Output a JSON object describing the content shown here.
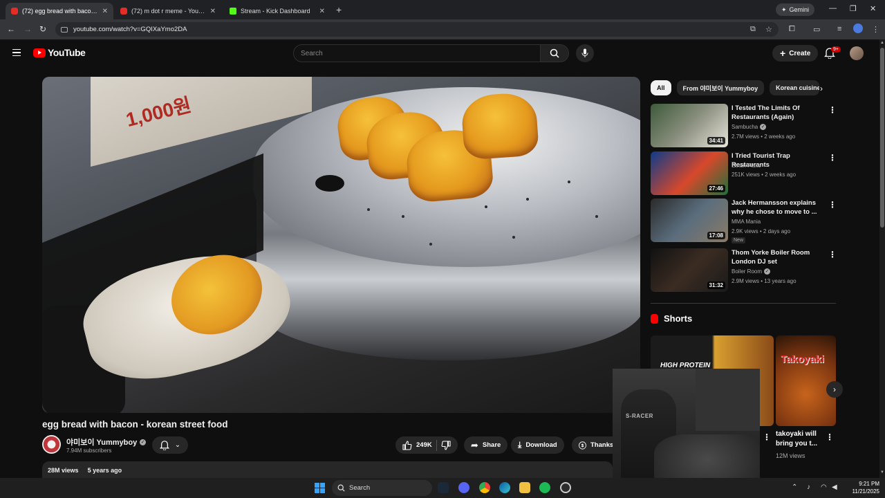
{
  "browser": {
    "tabs": [
      {
        "label": "(72) egg bread with bacon - ko",
        "active": true
      },
      {
        "label": "(72) m dot r meme - YouTube",
        "active": false
      },
      {
        "label": "Stream - Kick Dashboard",
        "active": false
      }
    ],
    "new_tab": "+",
    "gemini_label": "Gemini",
    "url": "youtube.com/watch?v=GQIXaYmo2DA"
  },
  "header": {
    "logo_text": "YouTube",
    "search_placeholder": "Search",
    "create_label": "Create",
    "notification_count": "9+"
  },
  "video": {
    "title": "egg bread with bacon - korean street food",
    "channel_name": "야미보이 Yummyboy",
    "subscribers": "7.94M subscribers",
    "likes": "249K",
    "share_label": "Share",
    "download_label": "Download",
    "thanks_label": "Thanks",
    "views": "28M views",
    "age": "5 years ago",
    "banner_text": "1,000원"
  },
  "sidebar": {
    "chips": [
      "All",
      "From 야미보이 Yummyboy",
      "Korean cuisine"
    ],
    "recommendations": [
      {
        "title": "I Tested The Limits Of Restaurants (Again)",
        "channel": "Sambucha",
        "verified": true,
        "meta": "2.7M views • 2 weeks ago",
        "duration": "34:41",
        "new": ""
      },
      {
        "title": "I Tried Tourist Trap Restaurants",
        "channel": "Ethan Flake",
        "verified": false,
        "meta": "251K views • 2 weeks ago",
        "duration": "27:46",
        "new": ""
      },
      {
        "title": "Jack Hermansson explains why he chose to move to ...",
        "channel": "MMA Mania",
        "verified": false,
        "meta": "2.9K views • 2 days ago",
        "duration": "17:08",
        "new": "New"
      },
      {
        "title": "Thom Yorke Boiler Room London DJ set",
        "channel": "Boiler Room",
        "verified": true,
        "meta": "2.9M views • 13 years ago",
        "duration": "31:32",
        "new": ""
      }
    ],
    "shorts_heading": "Shorts",
    "shorts": [
      {
        "title": "",
        "views": "",
        "overlay": "HIGH PROTEIN"
      },
      {
        "title": "takoyaki will bring you t...",
        "views": "12M views",
        "overlay": "Takoyaki"
      }
    ]
  },
  "webcam": {
    "brand": "S-RACER"
  },
  "taskbar": {
    "search_label": "Search",
    "time": "9:21 PM",
    "date": "11/21/2025"
  },
  "colors": {
    "accent": "#ff0000",
    "background": "#0f0f0f",
    "chip_bg": "#272727"
  }
}
